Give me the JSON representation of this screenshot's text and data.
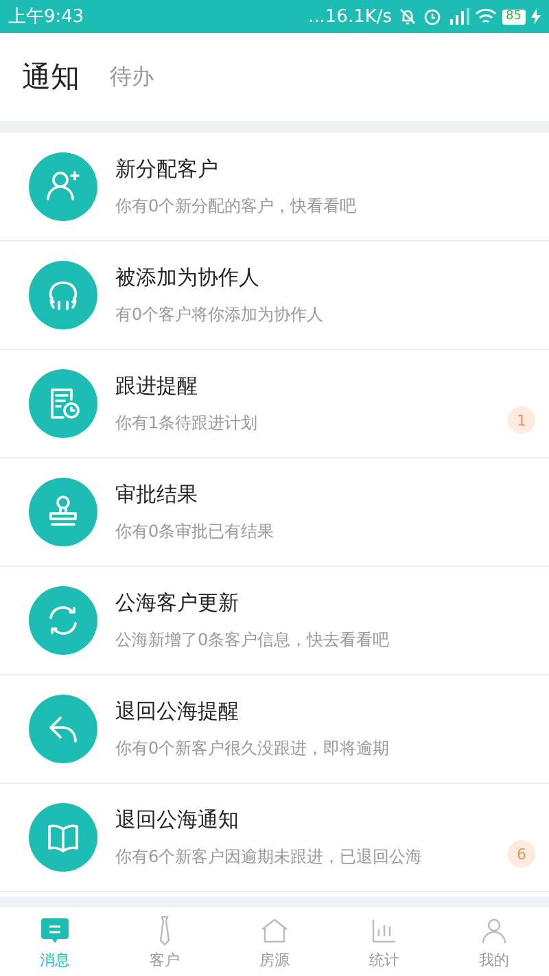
{
  "status_bar": {
    "time": "上午9:43",
    "speed": "...16.1K/s",
    "battery": "85"
  },
  "tabs": [
    {
      "label": "通知",
      "selected": true
    },
    {
      "label": "待办",
      "selected": false
    }
  ],
  "notifications": [
    {
      "title": "新分配客户",
      "subtitle": "你有0个新分配的客户，快看看吧"
    },
    {
      "title": "被添加为协作人",
      "subtitle": "有0个客户将你添加为协作人"
    },
    {
      "title": "跟进提醒",
      "subtitle": "你有1条待跟进计划",
      "badge": "1"
    },
    {
      "title": "审批结果",
      "subtitle": "你有0条审批已有结果"
    },
    {
      "title": "公海客户更新",
      "subtitle": "公海新增了0条客户信息，快去看看吧"
    },
    {
      "title": "退回公海提醒",
      "subtitle": "你有0个新客户很久没跟进，即将逾期"
    },
    {
      "title": "退回公海通知",
      "subtitle": "你有6个新客户因逾期未跟进，已退回公海",
      "badge": "6"
    }
  ],
  "bottom_nav": [
    {
      "label": "消息",
      "selected": true
    },
    {
      "label": "客户",
      "selected": false
    },
    {
      "label": "房源",
      "selected": false
    },
    {
      "label": "统计",
      "selected": false
    },
    {
      "label": "我的",
      "selected": false
    }
  ]
}
